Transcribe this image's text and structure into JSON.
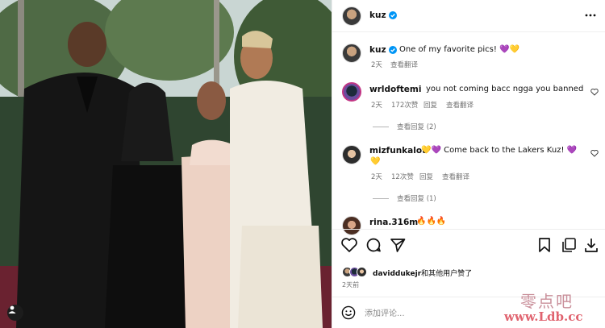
{
  "post": {
    "author": "kuz",
    "caption": {
      "user": "kuz",
      "text": "One of my favorite pics! 💜💛",
      "time": "2天",
      "translate": "查看翻译"
    }
  },
  "comments": [
    {
      "user": "wrldoftemi",
      "text": "you not coming bacc ngga you banned",
      "time": "2天",
      "likes": "172次赞",
      "reply": "回复",
      "translate": "查看翻译",
      "view_replies": "查看回复 (2)"
    },
    {
      "user": "mizfunkalot",
      "text_line1": "💛💜 Come back to the Lakers Kuz! 💜",
      "text_line2": "💛",
      "time": "2天",
      "likes": "12次赞",
      "reply": "回复",
      "translate": "查看翻译",
      "view_replies": "查看回复 (1)"
    },
    {
      "user": "rina.316m",
      "text": "🔥🔥🔥"
    }
  ],
  "likes": {
    "user": "daviddukejr",
    "rest": "和其他用户赞了"
  },
  "posted": "2天前",
  "comment_box": {
    "placeholder": "添加评论..."
  },
  "watermark": {
    "line1": "零点吧",
    "line2": "www.Ldb.cc"
  },
  "colors": {
    "verified": "#0095f6",
    "muted": "#737373",
    "border": "#efefef"
  }
}
